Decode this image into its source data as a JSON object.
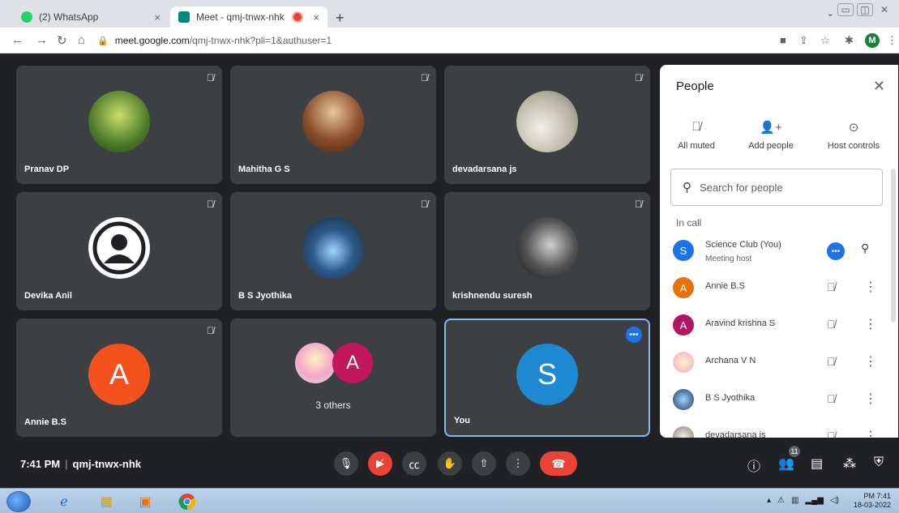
{
  "browser": {
    "tabs": [
      {
        "title": "(2) WhatsApp",
        "close": "×"
      },
      {
        "title": "Meet - qmj-tnwx-nhk",
        "close": "×"
      }
    ],
    "new_tab": "+",
    "url_host": "meet.google.com",
    "url_path": "/qmj-tnwx-nhk?pli=1&authuser=1",
    "profile_initial": "M"
  },
  "tiles": [
    {
      "name": "Pranav DP"
    },
    {
      "name": "Mahitha G S"
    },
    {
      "name": "devadarsana js"
    },
    {
      "name": "Devika Anil"
    },
    {
      "name": "B S Jyothika"
    },
    {
      "name": "krishnendu suresh"
    },
    {
      "name": "Annie B.S",
      "initial": "A"
    },
    {
      "others_initial": "A",
      "others_label": "3 others"
    },
    {
      "name": "You",
      "initial": "S"
    }
  ],
  "meetbar": {
    "time": "7:41 PM",
    "separator": "|",
    "meeting_code": "qmj-tnwx-nhk",
    "participant_count": "11"
  },
  "people": {
    "title": "People",
    "actions": [
      {
        "label": "All muted"
      },
      {
        "label": "Add people"
      },
      {
        "label": "Host controls"
      }
    ],
    "search_placeholder": "Search for people",
    "section": "In call",
    "participants": [
      {
        "initial": "S",
        "name": "Science Club (You)",
        "sub": "Meeting host",
        "color": "#1a73e8"
      },
      {
        "initial": "A",
        "name": "Annie B.S",
        "color": "#e8710a"
      },
      {
        "initial": "A",
        "name": "Aravind krishna S",
        "color": "#b31462"
      },
      {
        "initial": "",
        "name": "Archana V N",
        "color": "#f7c4e0"
      },
      {
        "initial": "",
        "name": "B S Jyothika",
        "color": "#1e3a5f"
      },
      {
        "initial": "",
        "name": "devadarsana js",
        "color": "#c9b8a0"
      }
    ]
  },
  "taskbar": {
    "clock_time": "PM 7:41",
    "clock_date": "18-03-2022"
  },
  "colors": {
    "annie_tile": "#f4511e",
    "you_tile": "#1e88d0",
    "others_avatar": "#c2185b"
  }
}
